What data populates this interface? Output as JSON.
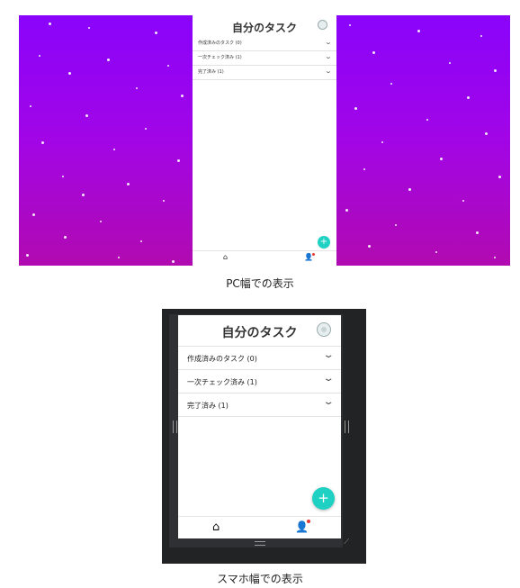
{
  "pc_view": {
    "title": "自分のタスク",
    "accordion": [
      {
        "label": "作成済みのタスク (0)"
      },
      {
        "label": "一次チェック済み (1)"
      },
      {
        "label": "完了済み (1)"
      }
    ],
    "fab_label": "+",
    "caption": "PC幅での表示"
  },
  "phone_view": {
    "title": "自分のタスク",
    "accordion": [
      {
        "label": "作成済みのタスク (0)"
      },
      {
        "label": "一次チェック済み (1)"
      },
      {
        "label": "完了済み (1)"
      }
    ],
    "fab_label": "+",
    "caption": "スマホ幅での表示"
  },
  "icons": {
    "chevron": "chevron-down-icon",
    "home": "home-icon",
    "people": "people-icon",
    "avatar": "user-avatar-icon",
    "add": "plus-icon"
  },
  "colors": {
    "gradient_top": "#8a04fb",
    "gradient_bottom": "#b10ab0",
    "fab": "#1ed1c2",
    "notification_dot": "#e53935",
    "frame": "#222325"
  }
}
